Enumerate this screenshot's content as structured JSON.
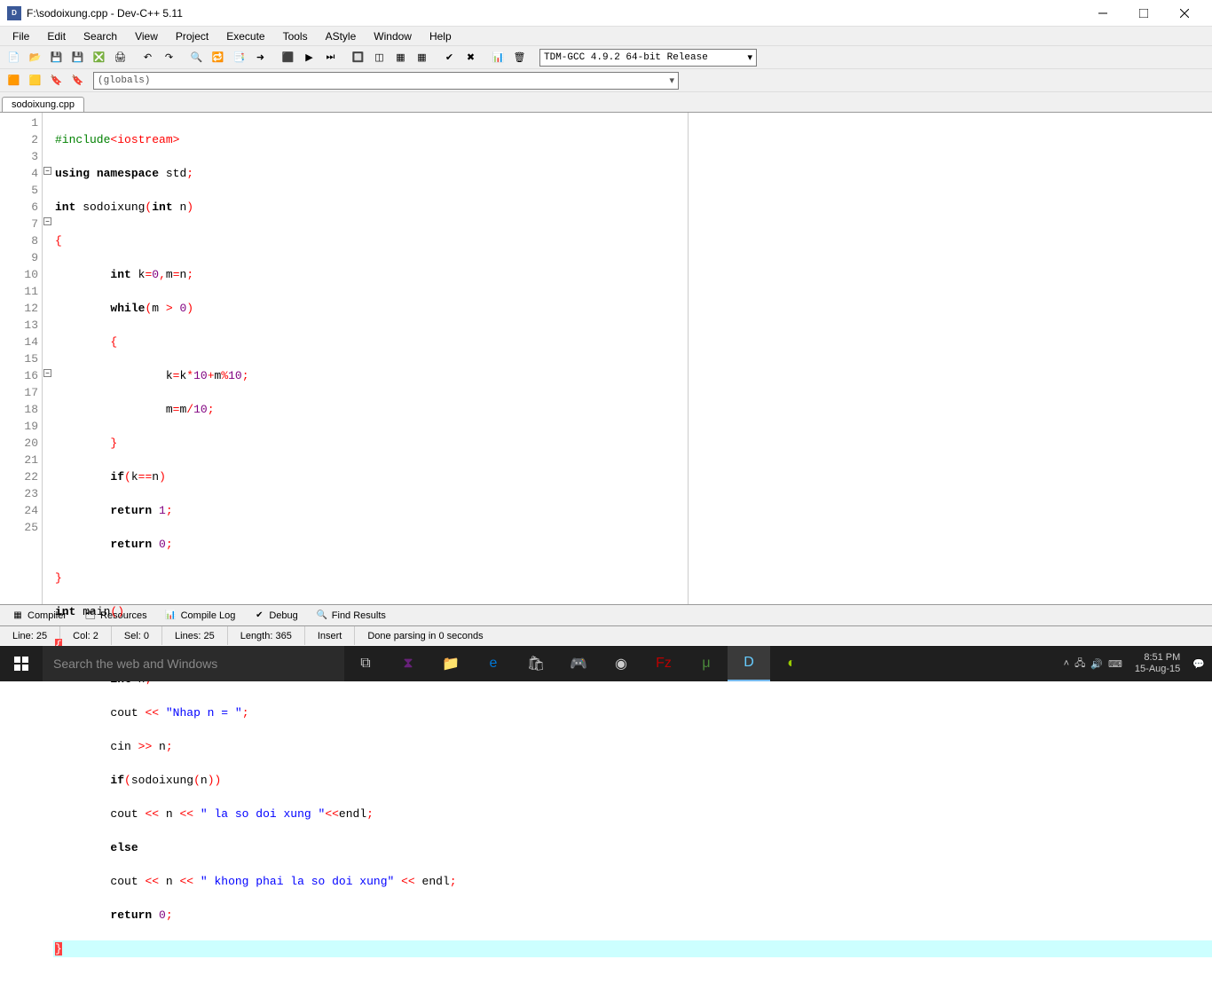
{
  "window": {
    "title": "F:\\sodoixung.cpp - Dev-C++ 5.11"
  },
  "menu": [
    "File",
    "Edit",
    "Search",
    "View",
    "Project",
    "Execute",
    "Tools",
    "AStyle",
    "Window",
    "Help"
  ],
  "compiler_combo": "TDM-GCC 4.9.2 64-bit Release",
  "globals_combo": "(globals)",
  "tab": "sodoixung.cpp",
  "line_count": 25,
  "fold_markers": [
    {
      "line": 4
    },
    {
      "line": 7
    },
    {
      "line": 16
    }
  ],
  "bottom_tabs": [
    "Compiler",
    "Resources",
    "Compile Log",
    "Debug",
    "Find Results"
  ],
  "status": {
    "line": "Line:   25",
    "col": "Col:   2",
    "sel": "Sel:   0",
    "lines": "Lines:   25",
    "length": "Length:   365",
    "mode": "Insert",
    "parse": "Done parsing in 0 seconds"
  },
  "taskbar": {
    "search_placeholder": "Search the web and Windows",
    "time": "8:51 PM",
    "date": "15-Aug-15"
  },
  "code": {
    "l1_a": "#include",
    "l1_b": "<iostream>",
    "l2_a": "using",
    "l2_b": " ",
    "l2_c": "namespace",
    "l2_d": " std",
    "l2_e": ";",
    "l3_a": "int",
    "l3_b": " sodoixung",
    "l3_c": "(",
    "l3_d": "int",
    "l3_e": " n",
    "l3_f": ")",
    "l4": "{",
    "l5_indent": "        ",
    "l5_a": "int",
    "l5_b": " k",
    "l5_c": "=",
    "l5_d": "0",
    "l5_e": ",",
    "l5_f": "m",
    "l5_g": "=",
    "l5_h": "n",
    "l5_i": ";",
    "l6_indent": "        ",
    "l6_a": "while",
    "l6_b": "(",
    "l6_c": "m ",
    "l6_d": ">",
    "l6_e": " ",
    "l6_f": "0",
    "l6_g": ")",
    "l7_indent": "        ",
    "l7": "{",
    "l8_indent": "                ",
    "l8_a": "k",
    "l8_b": "=",
    "l8_c": "k",
    "l8_d": "*",
    "l8_e": "10",
    "l8_f": "+",
    "l8_g": "m",
    "l8_h": "%",
    "l8_i": "10",
    "l8_j": ";",
    "l9_indent": "                ",
    "l9_a": "m",
    "l9_b": "=",
    "l9_c": "m",
    "l9_d": "/",
    "l9_e": "10",
    "l9_f": ";",
    "l10_indent": "        ",
    "l10": "}",
    "l11_indent": "        ",
    "l11_a": "if",
    "l11_b": "(",
    "l11_c": "k",
    "l11_d": "==",
    "l11_e": "n",
    "l11_f": ")",
    "l12_indent": "        ",
    "l12_a": "return",
    "l12_b": " ",
    "l12_c": "1",
    "l12_d": ";",
    "l13_indent": "        ",
    "l13_a": "return",
    "l13_b": " ",
    "l13_c": "0",
    "l13_d": ";",
    "l14": "}",
    "l15_a": "int",
    "l15_b": " main",
    "l15_c": "()",
    "l16": "{",
    "l17_indent": "        ",
    "l17_a": "int",
    "l17_b": " n",
    "l17_c": ";",
    "l18_indent": "        ",
    "l18_a": "cout ",
    "l18_b": "<<",
    "l18_c": " ",
    "l18_d": "\"Nhap n = \"",
    "l18_e": ";",
    "l19_indent": "        ",
    "l19_a": "cin ",
    "l19_b": ">>",
    "l19_c": " n",
    "l19_d": ";",
    "l20_indent": "        ",
    "l20_a": "if",
    "l20_b": "(",
    "l20_c": "sodoixung",
    "l20_d": "(",
    "l20_e": "n",
    "l20_f": "))",
    "l21_indent": "        ",
    "l21_a": "cout ",
    "l21_b": "<<",
    "l21_c": " n ",
    "l21_d": "<<",
    "l21_e": " ",
    "l21_f": "\" la so doi xung \"",
    "l21_g": "<<",
    "l21_h": "endl",
    "l21_i": ";",
    "l22_indent": "        ",
    "l22_a": "else",
    "l23_indent": "        ",
    "l23_a": "cout ",
    "l23_b": "<<",
    "l23_c": " n ",
    "l23_d": "<<",
    "l23_e": " ",
    "l23_f": "\" khong phai la so doi xung\"",
    "l23_g": " ",
    "l23_h": "<<",
    "l23_i": " endl",
    "l23_j": ";",
    "l24_indent": "        ",
    "l24_a": "return",
    "l24_b": " ",
    "l24_c": "0",
    "l24_d": ";",
    "l25": "}"
  }
}
